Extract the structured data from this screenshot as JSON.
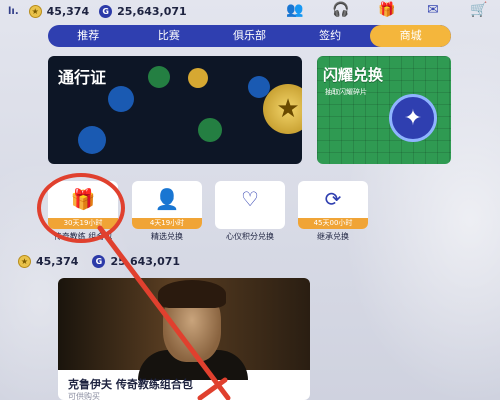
{
  "topbar": {
    "signal": "lı.",
    "coins": "45,374",
    "gems": "25,643,071",
    "icons": [
      "friends-icon",
      "headset-icon",
      "gift-icon",
      "mail-icon",
      "cart-icon"
    ]
  },
  "tabs": [
    "推荐",
    "比赛",
    "俱乐部",
    "签约",
    "商城"
  ],
  "active_tab": "商城",
  "banners": {
    "pass_title": "通行证",
    "flash_title": "闪耀兑换",
    "flash_sub": "抽取闪耀碎片"
  },
  "cards": [
    {
      "timer": "30天19小时",
      "label": "传奇教练 组合包",
      "icon": "gift-icon"
    },
    {
      "timer": "4天19小时",
      "label": "精选兑换",
      "icon": "exchange-person-icon"
    },
    {
      "timer": "",
      "label": "心仪积分兑换",
      "icon": "heart-icon"
    },
    {
      "timer": "45天00小时",
      "label": "继承兑换",
      "icon": "refresh-icon"
    }
  ],
  "bar2": {
    "coins": "45,374",
    "gems": "25,643,071"
  },
  "feature": {
    "name": "克鲁伊夫 传奇教练组合包",
    "desc": "可供购买"
  },
  "colors": {
    "nav_bg": "#2f3fb0",
    "accent": "#f4b63c",
    "annotation": "#e0402e"
  }
}
